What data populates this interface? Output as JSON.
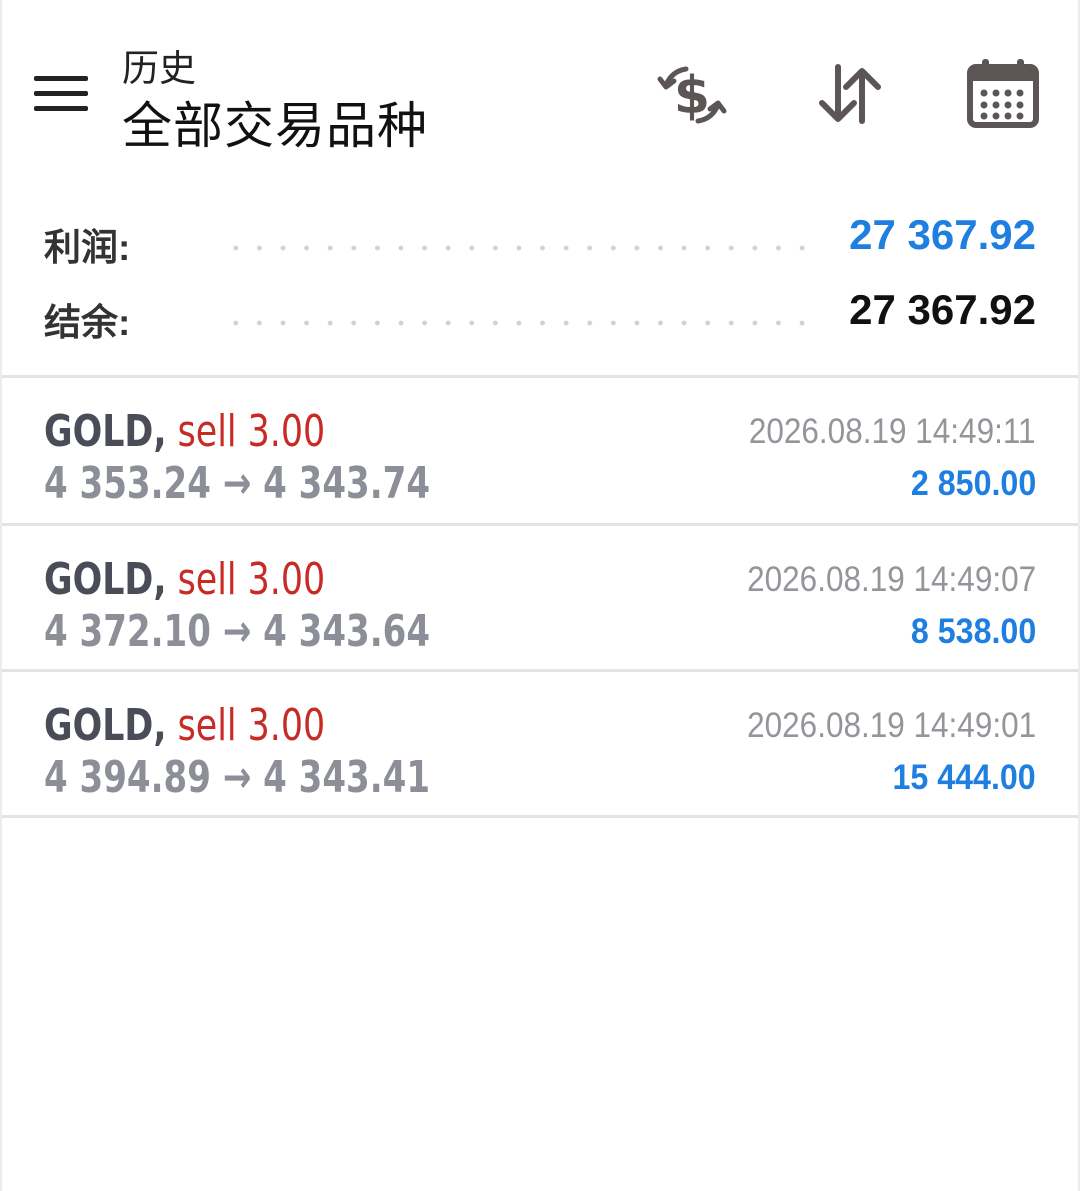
{
  "colors": {
    "accent_blue": "#1e7fe0",
    "sell_red": "#c82a25",
    "text_dark": "#111111",
    "text_gray": "#8d8f98",
    "icon_gray": "#5b5655"
  },
  "header": {
    "title": "历史",
    "subtitle": "全部交易品种",
    "icons": [
      "menu-icon",
      "currency-exchange-icon",
      "sort-icon",
      "calendar-icon"
    ]
  },
  "summary": {
    "profit_label": "利润:",
    "profit_value": "27 367.92",
    "balance_label": "结余:",
    "balance_value": "27 367.92"
  },
  "trades": [
    {
      "symbol": "GOLD",
      "comma": ",",
      "side": "sell 3.00",
      "prices": "4 353.24 → 4 343.74",
      "time": "2026.08.19 14:49:11",
      "profit": "2 850.00"
    },
    {
      "symbol": "GOLD",
      "comma": ",",
      "side": "sell 3.00",
      "prices": "4 372.10 → 4 343.64",
      "time": "2026.08.19 14:49:07",
      "profit": "8 538.00"
    },
    {
      "symbol": "GOLD",
      "comma": ",",
      "side": "sell 3.00",
      "prices": "4 394.89 → 4 343.41",
      "time": "2026.08.19 14:49:01",
      "profit": "15 444.00"
    }
  ]
}
